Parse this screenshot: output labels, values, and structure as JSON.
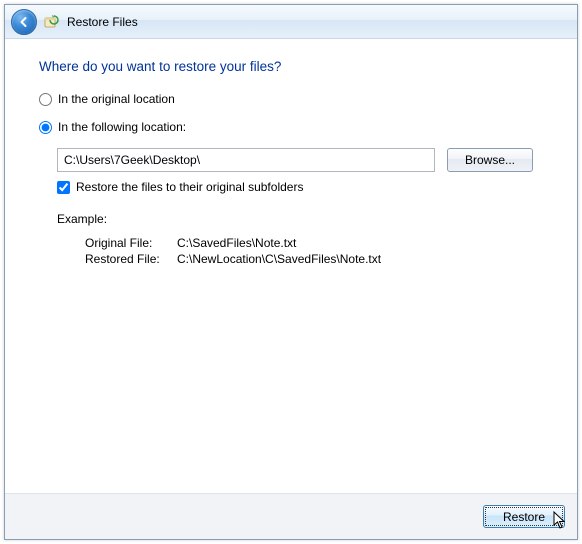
{
  "header": {
    "title": "Restore Files"
  },
  "main": {
    "heading": "Where do you want to restore your files?",
    "option_original": "In the original location",
    "option_following": "In the following location:",
    "path_value": "C:\\Users\\7Geek\\Desktop\\",
    "browse_label": "Browse...",
    "restore_subfolders_label": "Restore the files to their original subfolders",
    "example_label": "Example:",
    "example_original_label": "Original File:",
    "example_original_value": "C:\\SavedFiles\\Note.txt",
    "example_restored_label": "Restored File:",
    "example_restored_value": "C:\\NewLocation\\C\\SavedFiles\\Note.txt"
  },
  "footer": {
    "restore_label": "Restore"
  }
}
